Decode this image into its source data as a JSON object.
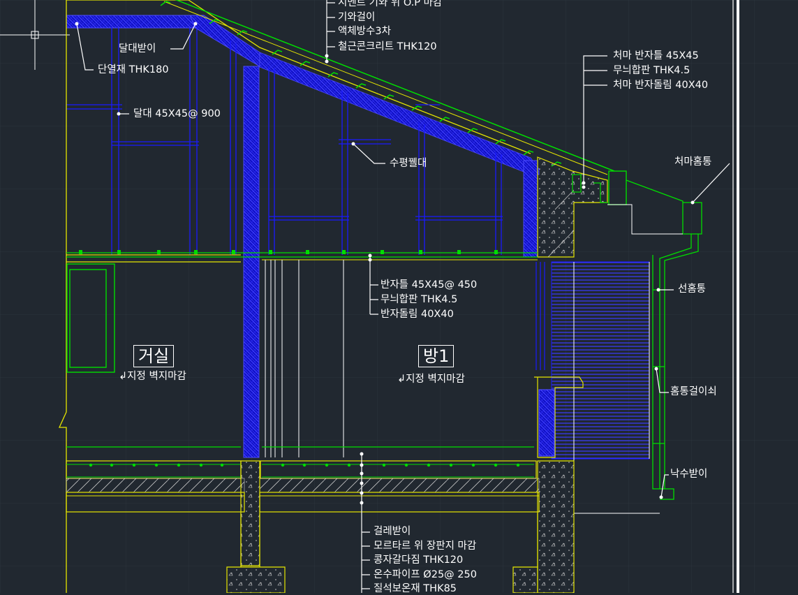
{
  "colors": {
    "background": "#212830",
    "grid": "#2c343d",
    "structure": "#e6e600",
    "insulation": "#1a1aff",
    "finish": "#00dd00",
    "leader": "#ffffff",
    "concrete_hatch": "#c8c8c8"
  },
  "labels": {
    "roof_cement_tile": "시멘트 기와 위 O.P 마감",
    "roof_tile_batten": "기와걸이",
    "roof_waterproof": "액체방수3차",
    "roof_rc_slab": "철근콘크리트 THK120",
    "ceiling_hanger": "달대받이",
    "insulation": "단열재 THK180",
    "hanger_spacing": "달대 45X45@ 900",
    "horizontal_brace": "수평꿸대",
    "eave_joist": "처마 반자틀 45X45",
    "eave_plywood": "무늬합판 THK4.5",
    "eave_rim": "처마 반자돌림 40X40",
    "eave_gutter": "처마홈통",
    "ceiling_joist": "반자틀 45X45@ 450",
    "ceiling_plywood": "무늬합판 THK4.5",
    "ceiling_rim": "반자돌림 40X40",
    "downpipe": "선홈통",
    "pipe_bracket": "홈통걸이쇠",
    "splash_block": "낙수받이",
    "floor_baseboard": "걸레받이",
    "floor_linoleum": "모르타르 위 장판지 마감",
    "floor_gravel": "콩자갈다짐 THK120",
    "floor_heating": "온수파이프 Ø25@ 250",
    "floor_insulation": "질석보온재 THK85"
  },
  "rooms": {
    "living_name": "거실",
    "living_finish": "지정 벽지마감",
    "room1_name": "방1",
    "room1_finish": "지정 벽지마감"
  }
}
